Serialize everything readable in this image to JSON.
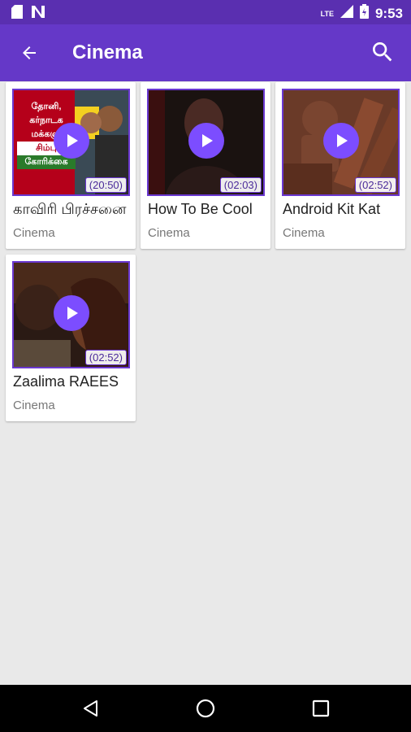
{
  "status_bar": {
    "time": "9:53",
    "network": "LTE",
    "icons": [
      "sd-card-icon",
      "notification-n-icon",
      "signal-icon",
      "battery-icon"
    ]
  },
  "app_bar": {
    "title": "Cinema",
    "back_icon": "arrow-back-icon",
    "search_icon": "search-icon",
    "color": "#6538c8"
  },
  "videos": [
    {
      "title": "காவிரி பிரச்சனை",
      "category": "Cinema",
      "duration": "(20:50)",
      "thumb_text": [
        "தோனி,",
        "கர்நாடக",
        "மக்களு",
        "சிம்பு",
        "கோரிக்கை"
      ]
    },
    {
      "title": "How To Be Cool",
      "category": "Cinema",
      "duration": "(02:03)"
    },
    {
      "title": "Android Kit Kat",
      "category": "Cinema",
      "duration": "(02:52)"
    },
    {
      "title": "Zaalima RAEES",
      "category": "Cinema",
      "duration": "(02:52)"
    }
  ],
  "nav_bar": {
    "icons": [
      "back-triangle-icon",
      "home-circle-icon",
      "recents-square-icon"
    ]
  },
  "colors": {
    "accent": "#7c4dff",
    "status_bar": "#5a2fb0",
    "background": "#e9e9e9"
  }
}
